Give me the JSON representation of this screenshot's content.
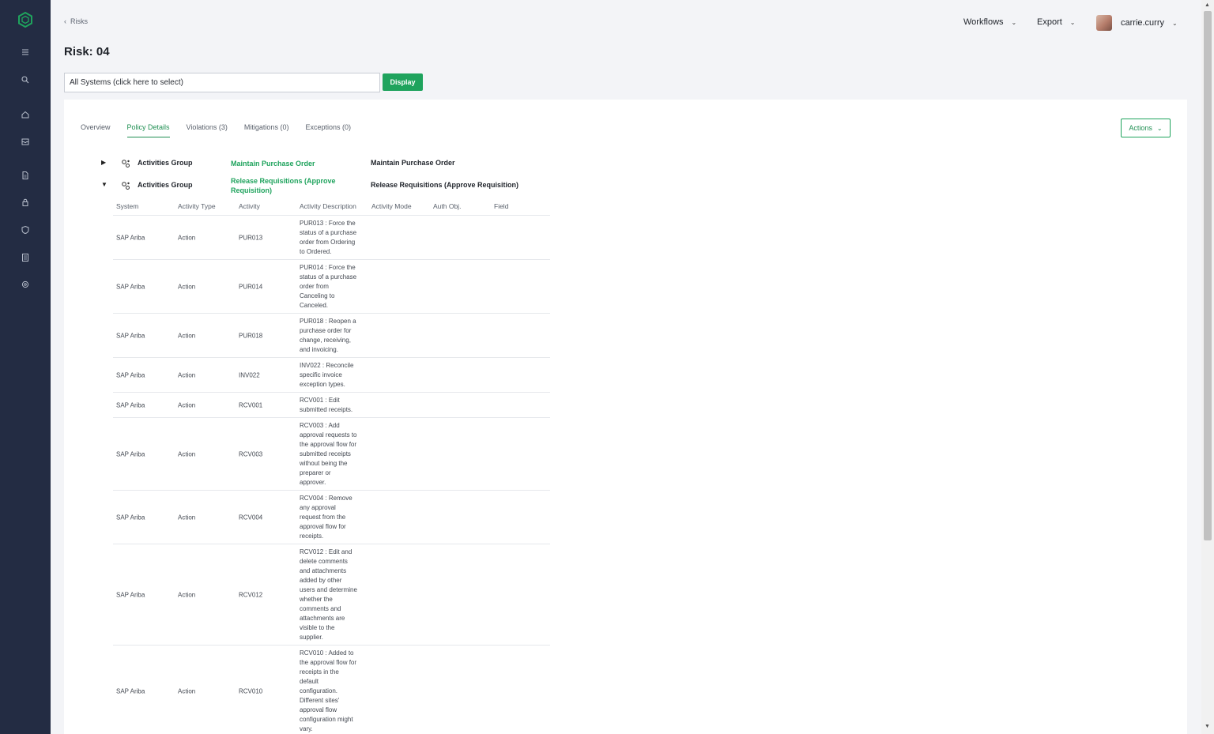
{
  "breadcrumb": {
    "back_label": "Risks"
  },
  "page_title": "Risk: 04",
  "top_nav": {
    "workflows": "Workflows",
    "export": "Export",
    "username": "carrie.curry"
  },
  "system_selector": {
    "value": "All Systems (click here to select)"
  },
  "display_button": "Display",
  "tabs": [
    {
      "label": "Overview",
      "active": false
    },
    {
      "label": "Policy Details",
      "active": true
    },
    {
      "label": "Violations (3)",
      "active": false
    },
    {
      "label": "Mitigations (0)",
      "active": false
    },
    {
      "label": "Exceptions (0)",
      "active": false
    }
  ],
  "actions_button": "Actions",
  "groups": [
    {
      "type": "Activities Group",
      "name": "Maintain Purchase Order",
      "description": "Maintain Purchase Order",
      "expanded": false
    },
    {
      "type": "Activities Group",
      "name": "Release Requisitions (Approve Requisition)",
      "description": "Release Requisitions (Approve Requisition)",
      "expanded": true
    }
  ],
  "table": {
    "columns": [
      "System",
      "Activity Type",
      "Activity",
      "Activity Description",
      "Activity Mode",
      "Auth Obj.",
      "Field"
    ],
    "rows": [
      {
        "system": "SAP Ariba",
        "type": "Action",
        "activity": "PUR013",
        "description": [
          "PUR013 : Force the",
          "status of a purchase",
          "order from Ordering",
          "to Ordered."
        ]
      },
      {
        "system": "SAP Ariba",
        "type": "Action",
        "activity": "PUR014",
        "description": [
          "PUR014 : Force the",
          "status of a purchase",
          "order from",
          "Canceling to",
          "Canceled."
        ]
      },
      {
        "system": "SAP Ariba",
        "type": "Action",
        "activity": "PUR018",
        "description": [
          "PUR018 : Reopen a",
          "purchase order for",
          "change, receiving,",
          "and invoicing."
        ]
      },
      {
        "system": "SAP Ariba",
        "type": "Action",
        "activity": "INV022",
        "description": [
          "INV022 : Reconcile",
          "specific invoice",
          "exception types."
        ]
      },
      {
        "system": "SAP Ariba",
        "type": "Action",
        "activity": "RCV001",
        "description": [
          "RCV001 : Edit",
          "submitted receipts."
        ]
      },
      {
        "system": "SAP Ariba",
        "type": "Action",
        "activity": "RCV003",
        "description": [
          "RCV003 : Add",
          "approval requests to",
          "the approval flow for",
          "submitted receipts",
          "without being the",
          "preparer or",
          "approver."
        ]
      },
      {
        "system": "SAP Ariba",
        "type": "Action",
        "activity": "RCV004",
        "description": [
          "RCV004 : Remove",
          "any approval",
          "request from the",
          "approval flow for",
          "receipts."
        ]
      },
      {
        "system": "SAP Ariba",
        "type": "Action",
        "activity": "RCV012",
        "description": [
          "RCV012 : Edit and",
          "delete comments",
          "and attachments",
          "added by other",
          "users and determine",
          "whether the",
          "comments and",
          "attachments are",
          "visible to the",
          "supplier."
        ]
      },
      {
        "system": "SAP Ariba",
        "type": "Action",
        "activity": "RCV010",
        "description": [
          "RCV010 : Added to",
          "the approval flow for",
          "receipts in the",
          "default",
          "configuration.",
          "Different sites'",
          "approval flow",
          "configuration might",
          "vary."
        ]
      }
    ]
  },
  "colors": {
    "sidebar": "#232c43",
    "accent": "#1fa35d"
  },
  "sidebar_icons": [
    "menu-icon",
    "search-icon",
    "home-icon",
    "inbox-icon",
    "document-icon",
    "lock-icon",
    "shield-icon",
    "report-icon",
    "gear-icon"
  ]
}
